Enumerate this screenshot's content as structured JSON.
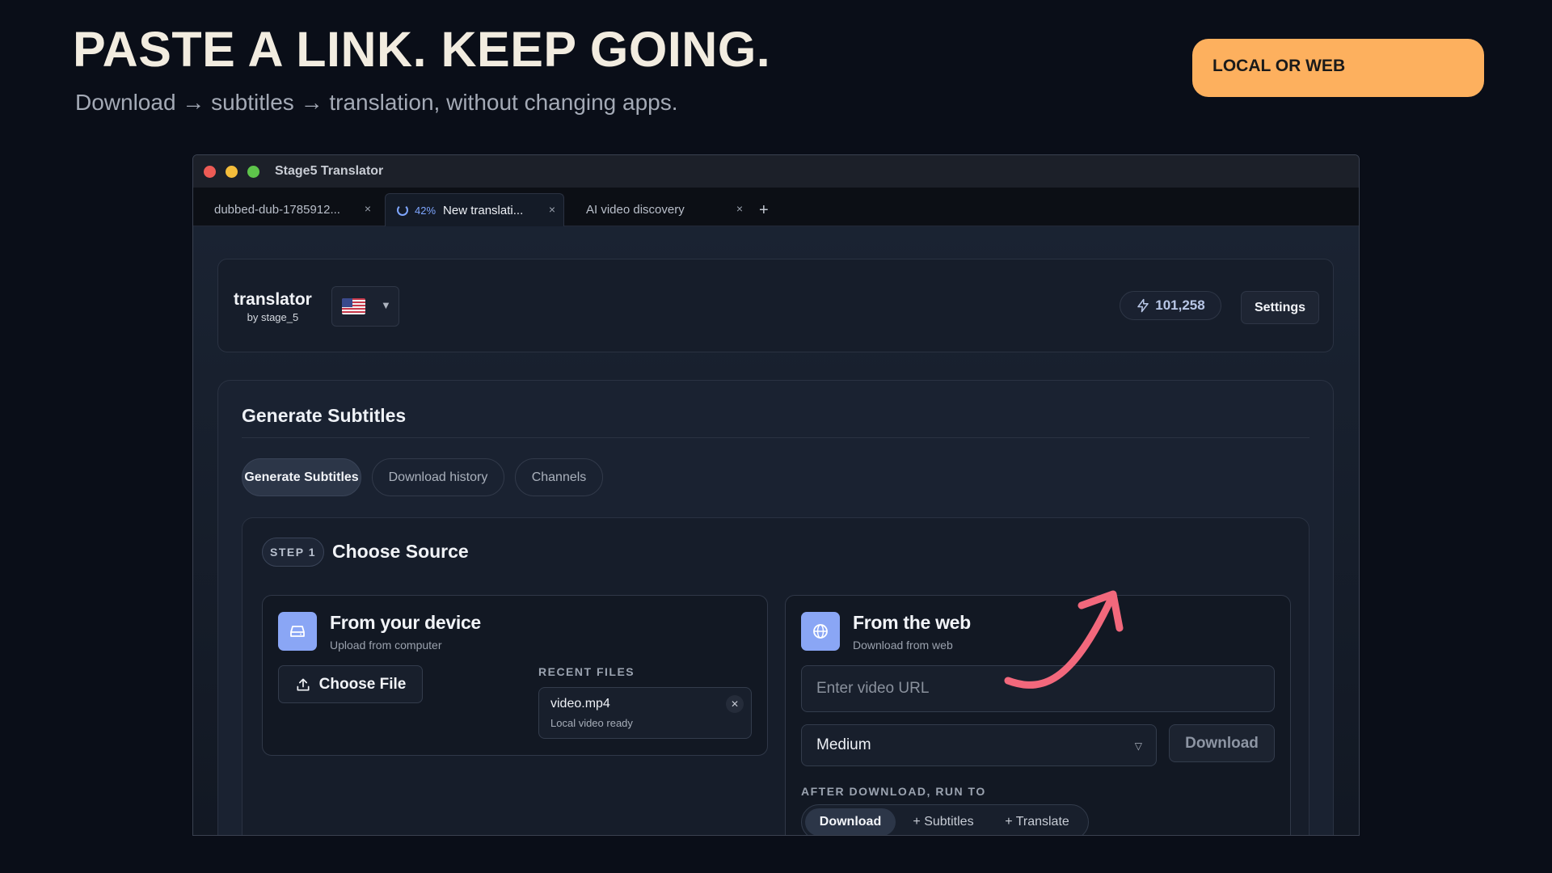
{
  "hero": {
    "title": "PASTE A LINK. KEEP GOING.",
    "subtitle": "Download → subtitles → translation, without changing apps.",
    "badge": "LOCAL OR WEB"
  },
  "window": {
    "title": "Stage5 Translator",
    "tabs": [
      {
        "label": "dubbed-dub-1785912...",
        "close": "×"
      },
      {
        "label": "New translati...",
        "progress": "42%",
        "close": "×"
      },
      {
        "label": "AI video discovery",
        "close": "×"
      }
    ],
    "new_tab": "+"
  },
  "header": {
    "brand": "translator",
    "brand_by": "by stage_5",
    "language_caret": "▼",
    "credits": "101,258",
    "settings_label": "Settings"
  },
  "main": {
    "title": "Generate Subtitles",
    "tabs": [
      "Generate Subtitles",
      "Download history",
      "Channels"
    ],
    "step": {
      "badge": "STEP 1",
      "title": "Choose Source",
      "device": {
        "title": "From your device",
        "subtitle": "Upload from computer",
        "choose_label": "Choose File",
        "recent_label": "RECENT FILES",
        "recent_files": [
          {
            "name": "video.mp4",
            "status": "Local video ready"
          }
        ]
      },
      "web": {
        "title": "From the web",
        "subtitle": "Download from web",
        "url_placeholder": "Enter video URL",
        "quality": "Medium",
        "download_label": "Download",
        "after_label": "AFTER DOWNLOAD, RUN TO",
        "after_options": [
          "Download",
          "+ Subtitles",
          "+ Translate"
        ]
      }
    }
  },
  "colors": {
    "accent_orange": "#fdb05e",
    "accent_blue": "#8aa6f5",
    "arrow_pink": "#f2687c"
  }
}
